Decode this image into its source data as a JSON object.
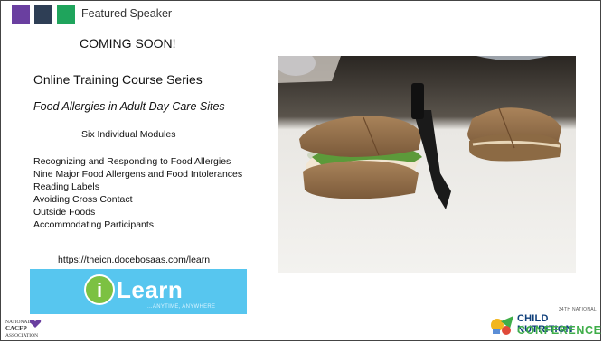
{
  "header": {
    "label": "Featured Speaker",
    "accent_colors": [
      "#6a3fa0",
      "#2e3e55",
      "#1fa45c"
    ]
  },
  "announcement": "COMING SOON!",
  "series_title": "Online Training Course Series",
  "course_title": "Food Allergies in Adult Day Care Sites",
  "modules_heading": "Six Individual Modules",
  "modules": [
    "Recognizing and Responding to Food Allergies",
    "Nine Major Food Allergens and Food Intolerances",
    "Reading Labels",
    "Avoiding Cross Contact",
    "Outside Foods",
    "Accommodating Participants"
  ],
  "url": "https://theicn.docebosaas.com/learn",
  "ilearn_logo": {
    "letter": "i",
    "word": "Learn",
    "tagline": "...ANYTIME, ANYWHERE"
  },
  "cacfp_logo": {
    "line1": "NATIONAL",
    "line2": "CACFP",
    "line3": "ASSOCIATION"
  },
  "conference_logo": {
    "edition": "34TH NATIONAL",
    "line1": "CHILD NUTRITION",
    "line2": "CONFERENCE"
  },
  "photo": {
    "subject": "sandwiches-cut-with-knife-photo"
  }
}
